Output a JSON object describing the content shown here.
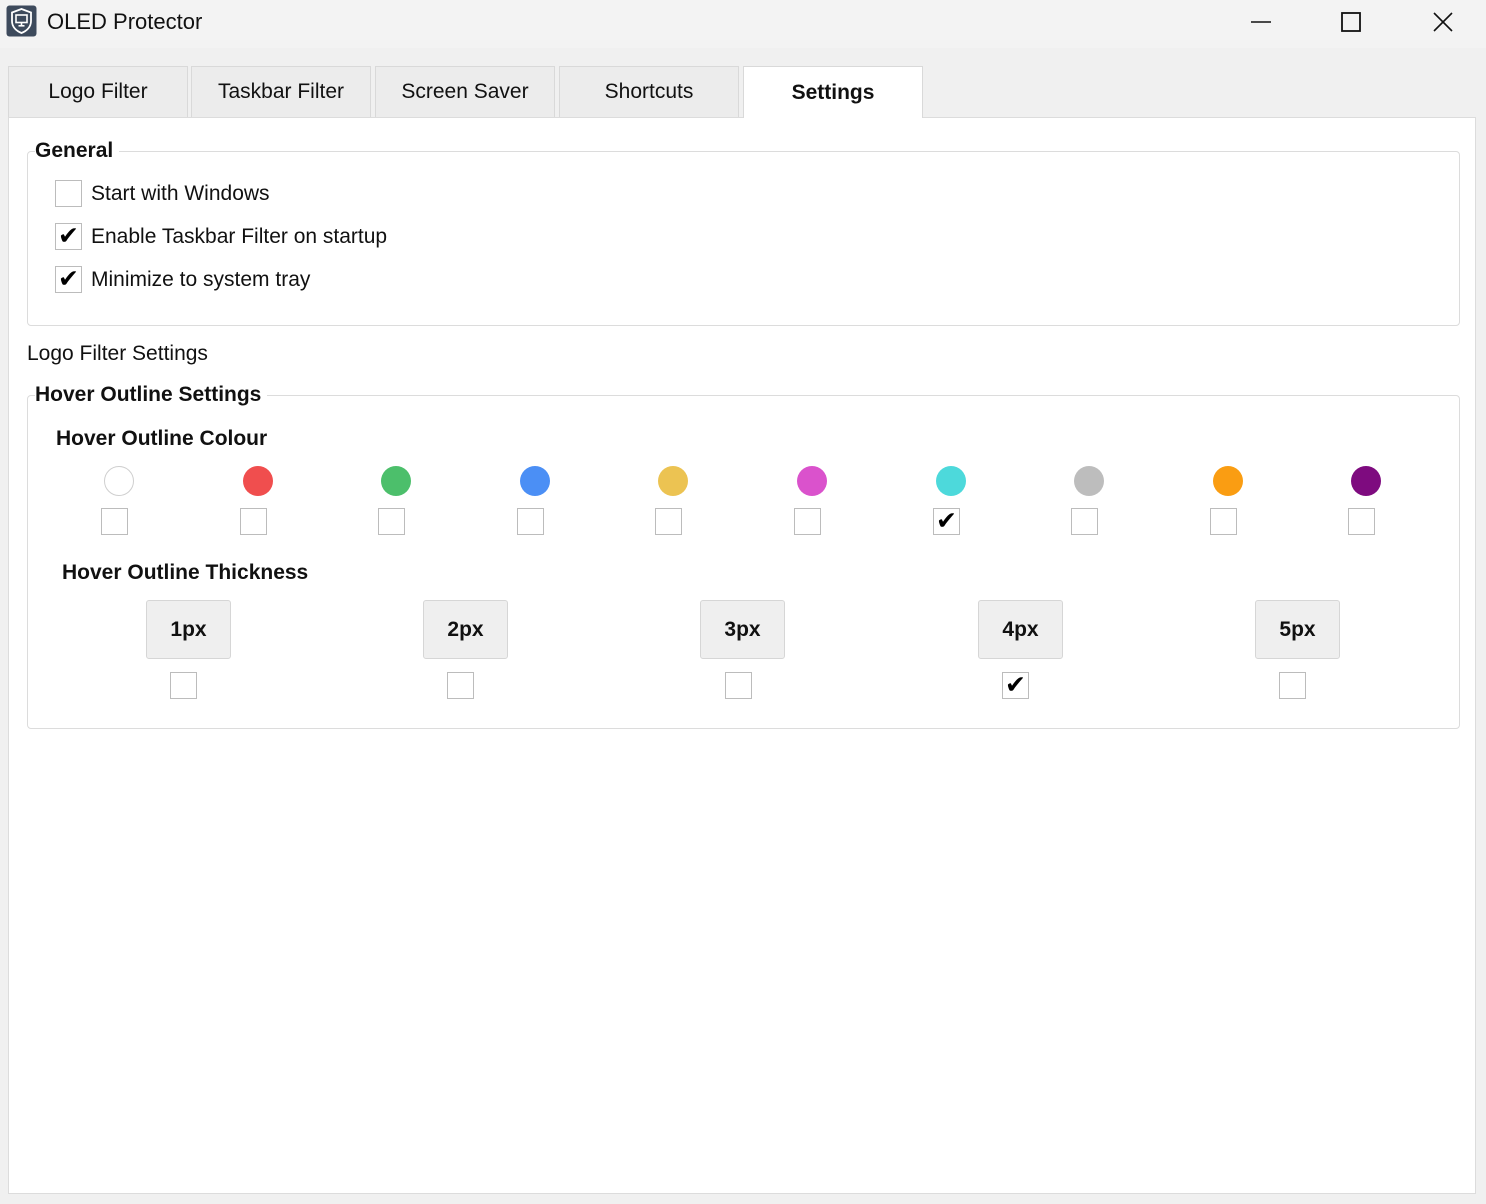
{
  "window": {
    "title": "OLED Protector",
    "icon": "monitor-shield-icon",
    "controls": [
      "minimize-icon",
      "maximize-icon",
      "close-icon"
    ]
  },
  "tabs": [
    {
      "label": "Logo Filter",
      "active": false
    },
    {
      "label": "Taskbar Filter",
      "active": false
    },
    {
      "label": "Screen Saver",
      "active": false
    },
    {
      "label": "Shortcuts",
      "active": false
    },
    {
      "label": "Settings",
      "active": true
    }
  ],
  "general": {
    "title": "General",
    "options": [
      {
        "label": "Start with Windows",
        "checked": false
      },
      {
        "label": "Enable Taskbar Filter on startup",
        "checked": true
      },
      {
        "label": "Minimize to system tray",
        "checked": true
      }
    ]
  },
  "logo_filter_settings": {
    "title": "Logo Filter Settings"
  },
  "hover_outline": {
    "title": "Hover Outline Settings",
    "colour_title": "Hover Outline Colour",
    "colours": [
      {
        "color": "#ffffff",
        "checked": false
      },
      {
        "color": "#f04e4e",
        "checked": false
      },
      {
        "color": "#4cbf6b",
        "checked": false
      },
      {
        "color": "#4b8ff5",
        "checked": false
      },
      {
        "color": "#ecc352",
        "checked": false
      },
      {
        "color": "#da52cc",
        "checked": false
      },
      {
        "color": "#4dd9db",
        "checked": true
      },
      {
        "color": "#bdbdbd",
        "checked": false
      },
      {
        "color": "#fa9d12",
        "checked": false
      },
      {
        "color": "#7e0b7f",
        "checked": false
      }
    ],
    "thickness_title": "Hover Outline Thickness",
    "thickness": [
      {
        "label": "1px",
        "checked": false
      },
      {
        "label": "2px",
        "checked": false
      },
      {
        "label": "3px",
        "checked": false
      },
      {
        "label": "4px",
        "checked": true
      },
      {
        "label": "5px",
        "checked": false
      }
    ]
  }
}
